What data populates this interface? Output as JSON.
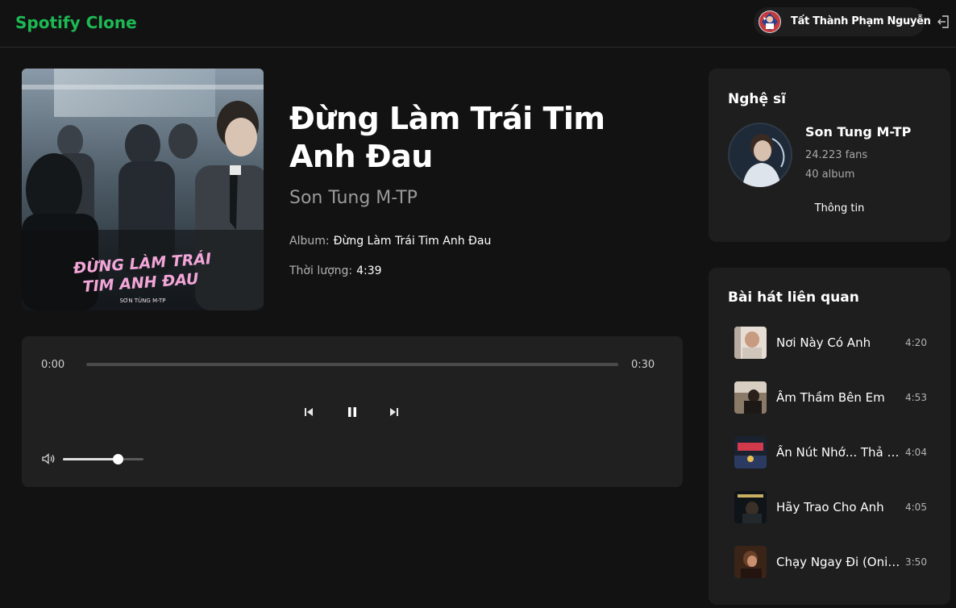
{
  "header": {
    "brand": "Spotify Clone",
    "user_name": "Tất Thành Phạm Nguyễn",
    "brand_color": "#1db954"
  },
  "song": {
    "title": "Đừng Làm Trái Tim Anh Đau",
    "artist": "Son Tung M-TP",
    "album_label": "Album:",
    "album": "Đừng Làm Trái Tim Anh Đau",
    "duration_label": "Thời lượng:",
    "duration": "4:39",
    "cover_text_line1": "ĐỪNG LÀM TRÁI",
    "cover_text_line2": "TIM ANH ĐAU",
    "cover_credit": "SƠN TÙNG M-TP"
  },
  "player": {
    "current_time": "0:00",
    "total_time": "0:30",
    "progress": 0.0,
    "volume": 0.68,
    "state": "playing"
  },
  "artist_card": {
    "title": "Nghệ sĩ",
    "name": "Son Tung M-TP",
    "fans": "24.223 fans",
    "albums": "40 album",
    "info_button": "Thông tin"
  },
  "related": {
    "title": "Bài hát liên quan",
    "items": [
      {
        "name": "Nơi Này Có Anh",
        "duration": "4:20"
      },
      {
        "name": "Âm Thầm Bên Em",
        "duration": "4:53"
      },
      {
        "name": "Ấn Nút Nhớ... Thả Giấc Mơ",
        "duration": "4:04"
      },
      {
        "name": "Hãy Trao Cho Anh",
        "duration": "4:05"
      },
      {
        "name": "Chạy Ngay Đi (Onionn Remix)",
        "duration": "3:50"
      }
    ]
  }
}
